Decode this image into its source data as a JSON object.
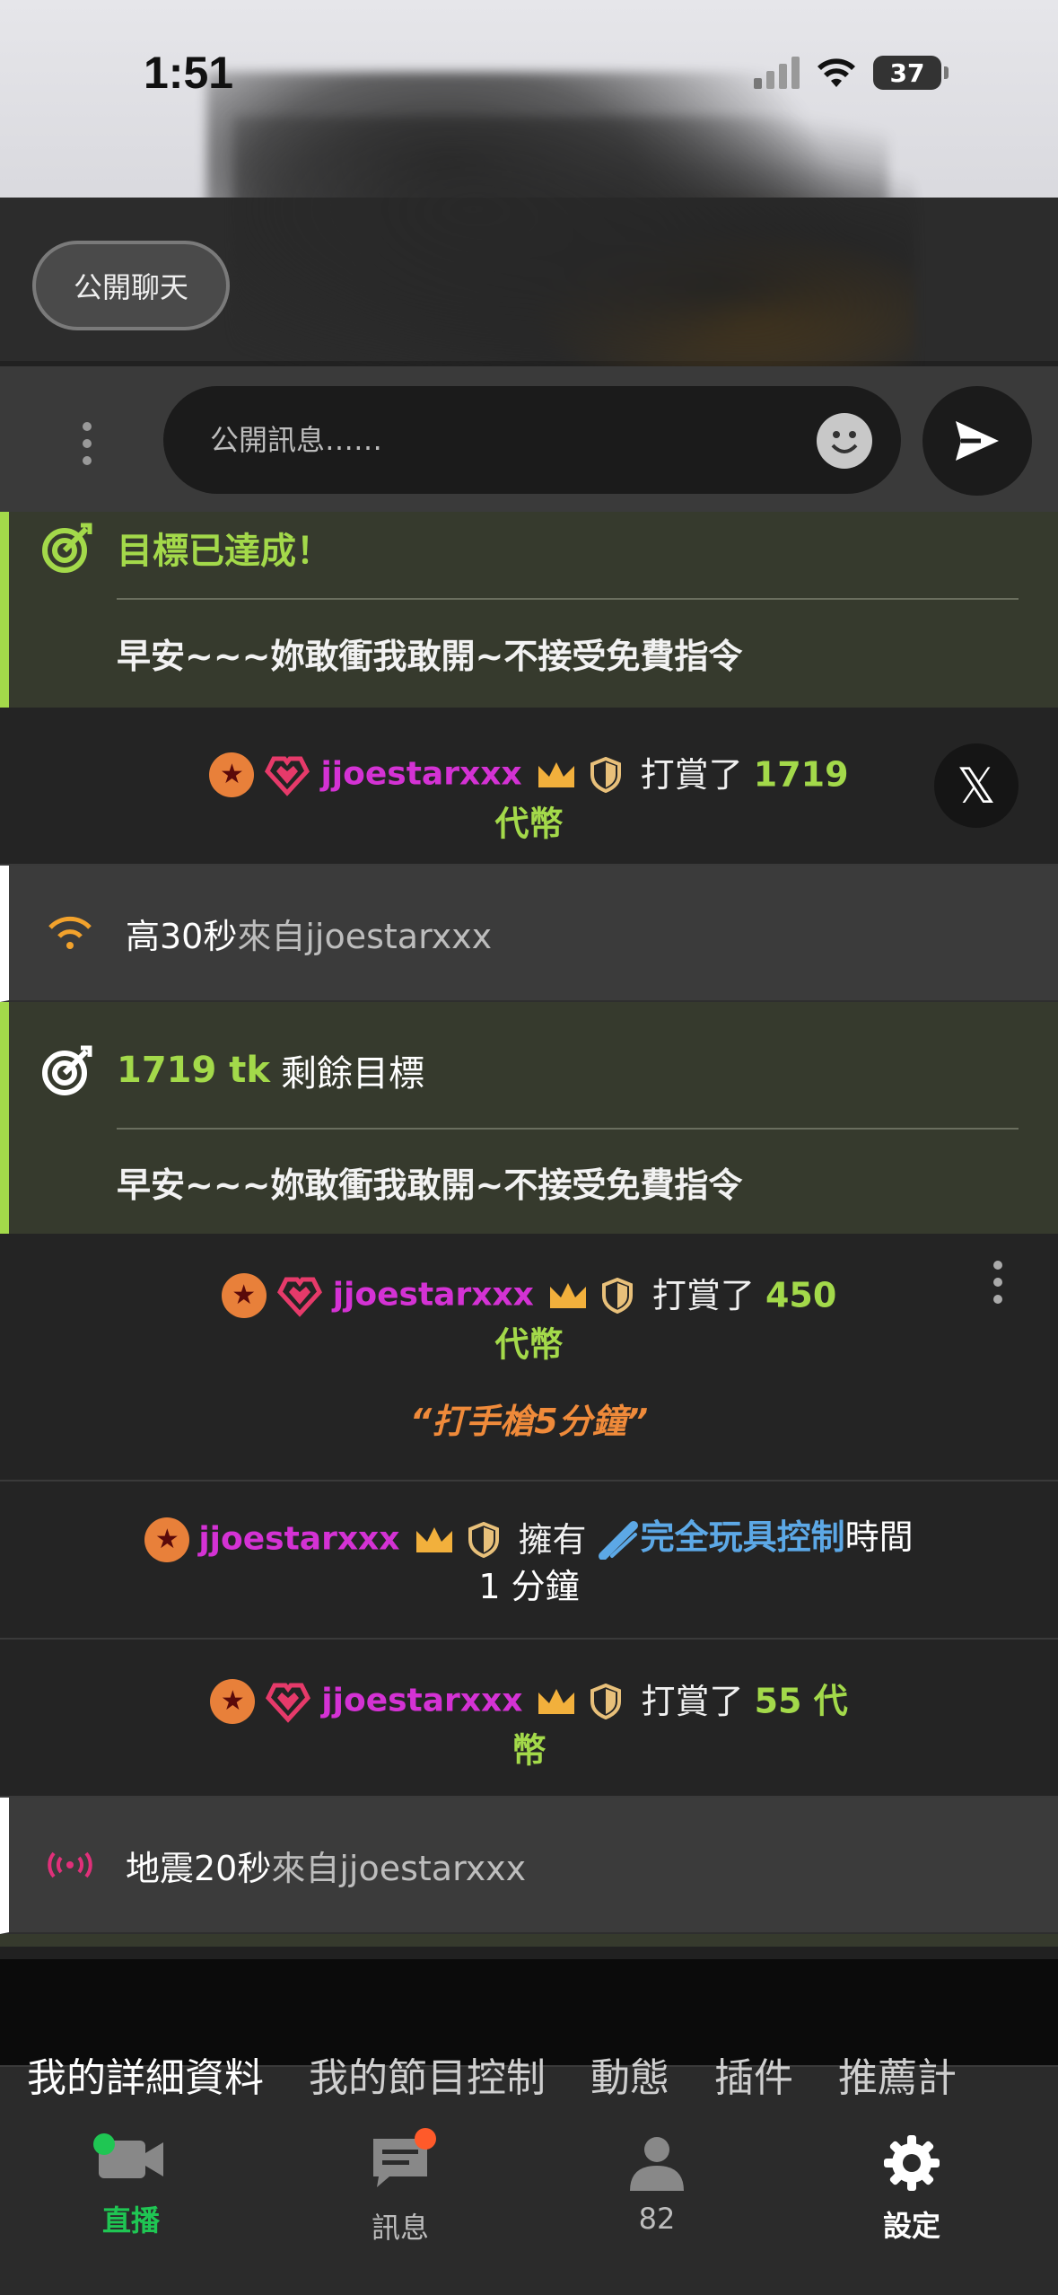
{
  "status_bar": {
    "time": "1:51",
    "battery": "37"
  },
  "header": {
    "public_chat_label": "公開聊天"
  },
  "composer": {
    "placeholder": "公開訊息……"
  },
  "messages": {
    "goal1": {
      "title": "目標已達成！",
      "body": "早安~~~妳敢衝我敢開~不接受免費指令"
    },
    "tip1": {
      "username": "jjoestarxxx",
      "tipped": "打賞了",
      "amount_line1": "1719",
      "amount_line2": "代幣"
    },
    "sys1": {
      "strong": "高30秒",
      "from": "來自jjoestarxxx"
    },
    "goal2": {
      "amount": "1719 tk",
      "remaining": "剩餘目標",
      "body": "早安~~~妳敢衝我敢開~不接受免費指令"
    },
    "tip2": {
      "username": "jjoestarxxx",
      "tipped": "打賞了",
      "amount_line1": "450",
      "amount_line2": "代幣",
      "note": "“打手槍5分鐘”"
    },
    "control": {
      "username": "jjoestarxxx",
      "has": "擁有",
      "feature": "完全玩具控制",
      "time_word": "時間",
      "duration": "1 分鐘"
    },
    "tip3": {
      "username": "jjoestarxxx",
      "tipped": "打賞了",
      "amount_line1": "55 代",
      "amount_line2": "幣"
    },
    "sys2": {
      "strong": "地震20秒",
      "from": "來自jjoestarxxx"
    }
  },
  "segment_tabs": [
    "我的詳細資料",
    "我的節目控制",
    "動態",
    "插件",
    "推薦計"
  ],
  "tab_bar": {
    "live": "直播",
    "messages": "訊息",
    "viewers": "82",
    "settings": "設定"
  },
  "colors": {
    "accent_green": "#a3d94a",
    "username": "#d432d4",
    "live_green": "#1fc653",
    "toy_blue": "#5ca8e6"
  },
  "icons": [
    "target-icon",
    "star-badge-icon",
    "heart-badge-icon",
    "crown-icon",
    "shield-icon",
    "wifi-vibe-icon",
    "x-logo-icon",
    "toy-icon",
    "earthquake-icon",
    "video-camera-icon",
    "chat-icon",
    "person-icon",
    "gear-icon",
    "send-icon",
    "emoji-icon"
  ]
}
